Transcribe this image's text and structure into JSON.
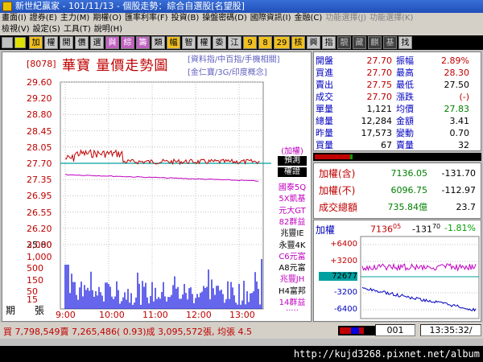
{
  "window": {
    "title": "新世紀贏家 - 101/11/13 - 個股走勢：綜合自選股[名望股]"
  },
  "menu": {
    "row1": [
      "畫面(I)",
      "證券(E)",
      "主力(M)",
      "期權(O)",
      "匯率利率(F)",
      "投資(B)",
      "操盤密碼(D)",
      "國際資訊(I)",
      "金融(C)",
      "功能選擇(J)",
      "功能選擇(K)"
    ],
    "row2": [
      "檢視(V)",
      "設定(S)",
      "工具(T)",
      "說明(H)"
    ]
  },
  "toolbar": {
    "buttons": [
      "加",
      "權",
      "開",
      "價",
      "選",
      "與",
      "綜",
      "籌",
      "類",
      "幅",
      "智",
      "權",
      "委",
      "江",
      "9",
      "8",
      "29",
      "核",
      "興",
      "指",
      "靚",
      "藏",
      "麒",
      "基",
      "找"
    ]
  },
  "stock": {
    "code": "[8078]",
    "name": "華寶  量價走勢圖",
    "index_line1": "[資料指/中百指/手機相關]",
    "index_line2": "[金仁寶/3G/印度概念]"
  },
  "yaxis": {
    "price": [
      "29.60",
      "29.20",
      "28.80",
      "28.45",
      "28.05",
      "27.70",
      "27.35",
      "26.95",
      "26.55",
      "26.20",
      "25.80"
    ],
    "volume": [
      "3,000",
      "1,000",
      "500",
      "150",
      "50",
      "15"
    ],
    "period_label": "期",
    "volume_label": "張"
  },
  "xaxis": {
    "ticks": [
      "9:00",
      "10:00",
      "11:00",
      "12:00",
      "13:00"
    ]
  },
  "side": {
    "add_label": "(加權)",
    "buttons": [
      "預測",
      "權證"
    ],
    "warrants": [
      {
        "label": "國泰5Q",
        "color": "#c000c0"
      },
      {
        "label": "5X凱基",
        "color": "#c000c0"
      },
      {
        "label": "元大GT",
        "color": "#c000c0"
      },
      {
        "label": "82群益",
        "color": "#c000c0"
      },
      {
        "label": "兆豐IE",
        "color": "#000000"
      },
      {
        "label": "永豐4K",
        "color": "#000000"
      },
      {
        "label": "C6元富",
        "color": "#c000c0"
      },
      {
        "label": "A8元富",
        "color": "#000000"
      },
      {
        "label": "兆豐JH",
        "color": "#c000c0"
      },
      {
        "label": "H4富邦",
        "color": "#000000"
      },
      {
        "label": "14群益",
        "color": "#c000c0"
      },
      {
        "label": "·····",
        "color": "#c000c0"
      }
    ]
  },
  "quote": [
    {
      "l1": "開盤",
      "v1": "27.70",
      "l2": "振幅",
      "v2": "2.89%",
      "c1": "#c00000",
      "c2": "#c00000"
    },
    {
      "l1": "買進",
      "v1": "27.70",
      "l2": "最高",
      "v2": "28.30",
      "c1": "#c00000",
      "c2": "#c00000"
    },
    {
      "l1": "賣出",
      "v1": "27.75",
      "l2": "最低",
      "v2": "27.50",
      "c1": "#c00000",
      "c2": "#000000"
    },
    {
      "l1": "成交",
      "v1": "27.70",
      "l2": "漲跌",
      "v2": "(-)",
      "c1": "#c00000",
      "c2": "#c00000"
    },
    {
      "l1": "單量",
      "v1": "1,121",
      "l2": "均價",
      "v2": "27.83",
      "c1": "#000000",
      "c2": "#008000"
    },
    {
      "l1": "總量",
      "v1": "12,284",
      "l2": "金額",
      "v2": "3.41",
      "c1": "#000000",
      "c2": "#000000"
    },
    {
      "l1": "昨量",
      "v1": "17,573",
      "l2": "變動",
      "v2": "0.70",
      "c1": "#000000",
      "c2": "#000000"
    },
    {
      "l1": "買量",
      "v1": "67",
      "l2": "賣量",
      "v2": "32",
      "c1": "#000000",
      "c2": "#000000"
    }
  ],
  "weighted": [
    {
      "label": "加權(含)",
      "value": "7136.05",
      "change": "-131.70",
      "cv": "#008000",
      "cc": "#000000"
    },
    {
      "label": "加權(不)",
      "value": "6096.75",
      "change": "-112.97",
      "cv": "#008000",
      "cc": "#000000"
    },
    {
      "label": "成交總額",
      "value": "735.84億",
      "change": "23.7",
      "cv": "#008000",
      "cc": "#000000"
    }
  ],
  "mini": {
    "title": "加權",
    "value": "7136",
    "value_dec": "05",
    "change": "-131",
    "change_dec": "70",
    "pct": "-1.81%",
    "ylabels": [
      "+6400",
      "+3200",
      "72677",
      "-3200",
      "-6400"
    ]
  },
  "status": {
    "trade_text": "買 7,798,549賣 7,265,486( 0.93)成 3,095,572張, 均張 4.5",
    "code_box": "001",
    "time": "13:35:32/"
  },
  "url": "http://kujd3268.pixnet.net/album",
  "colors": {
    "up": "#c00000",
    "down": "#008000",
    "price_line": "#c00000",
    "avg_line": "#c000c0",
    "volume": "#0000e0"
  }
}
